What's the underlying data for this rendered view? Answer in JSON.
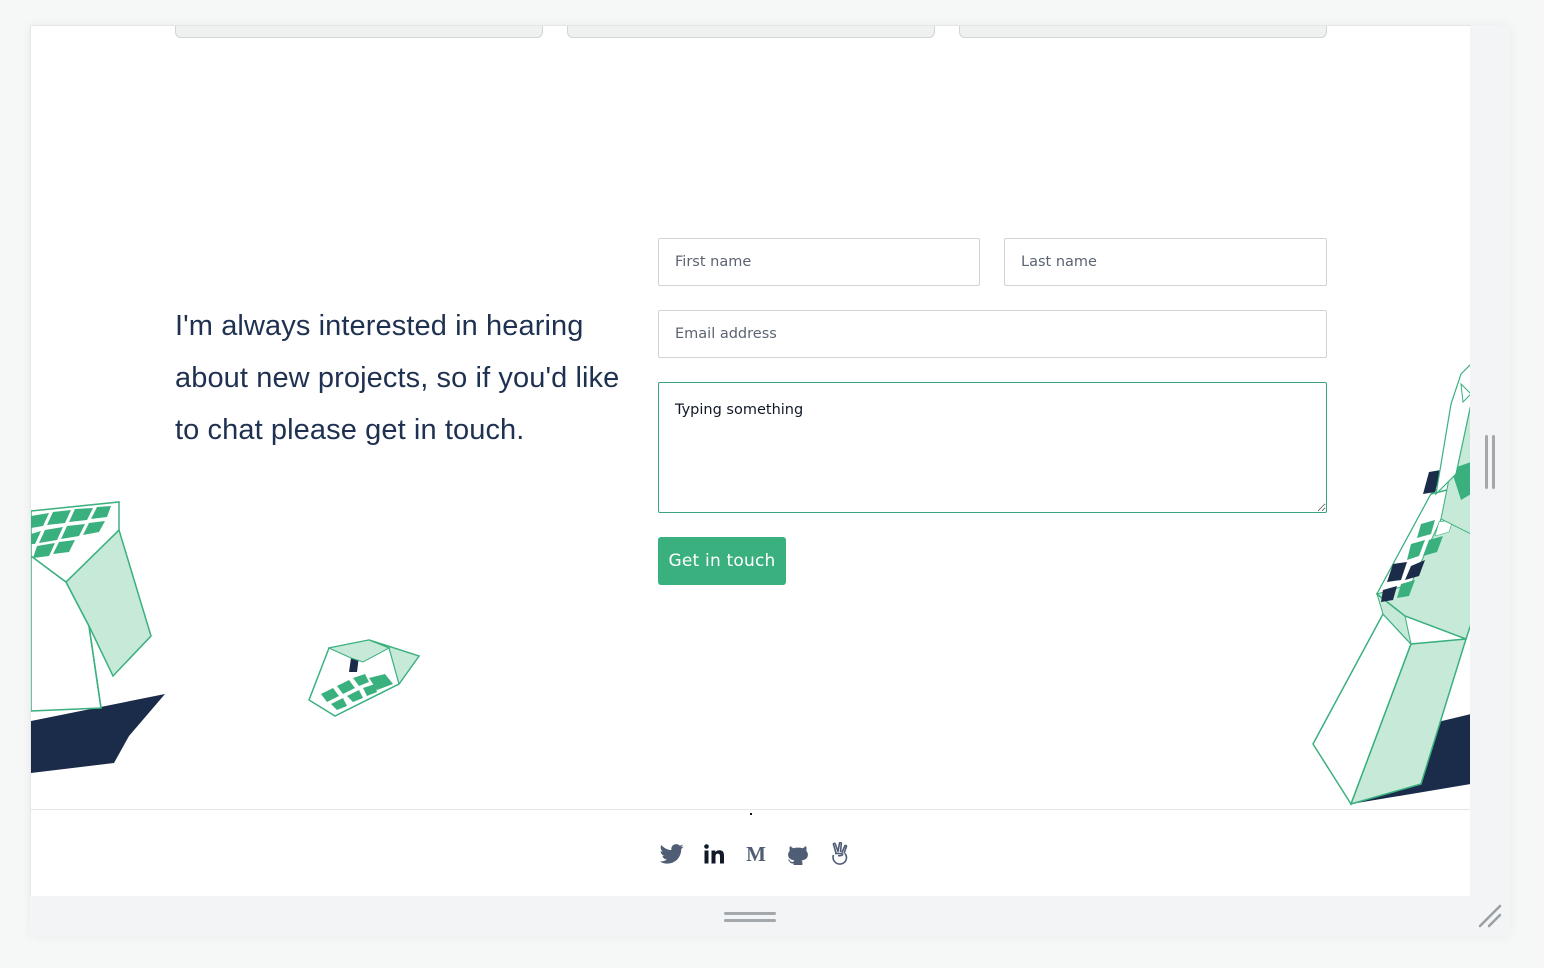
{
  "contact": {
    "intro_text": "I'm always interested in hearing about new projects, so if you'd like to chat please get in touch.",
    "first_name_placeholder": "First name",
    "last_name_placeholder": "Last name",
    "email_placeholder": "Email address",
    "message_value": "Typing something",
    "submit_label": "Get in touch"
  },
  "footer": {
    "socials": [
      {
        "name": "twitter-icon"
      },
      {
        "name": "linkedin-icon"
      },
      {
        "name": "medium-icon"
      },
      {
        "name": "github-icon"
      },
      {
        "name": "angellist-icon"
      }
    ]
  },
  "colors": {
    "accent": "#3ab07e",
    "text_dark": "#1f3150",
    "gem_light": "#c6e9d8",
    "gem_mid": "#3ab07e",
    "gem_dark": "#1b2b4a",
    "icon_slate": "#4f5d75"
  }
}
